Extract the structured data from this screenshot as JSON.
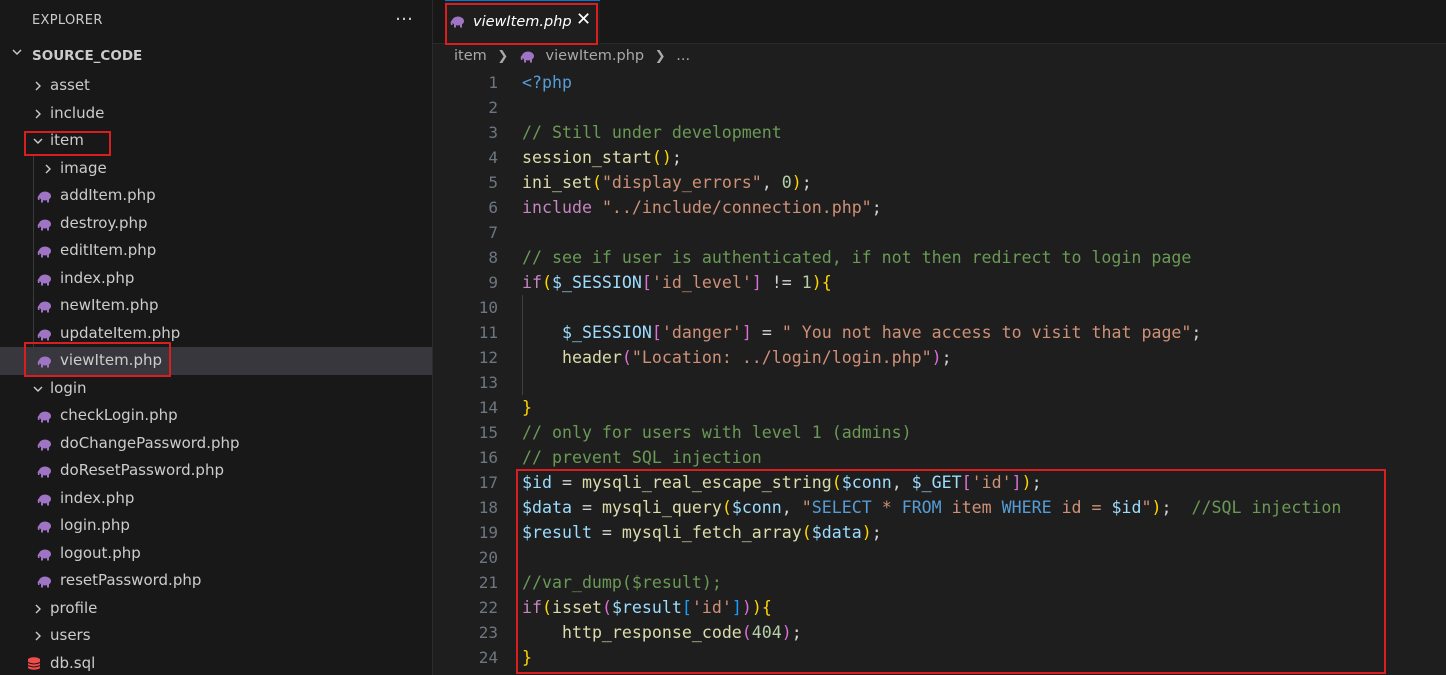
{
  "sidebar": {
    "title": "EXPLORER",
    "more_icon": "…",
    "root_label": "SOURCE_CODE",
    "items": [
      {
        "label": "asset",
        "kind": "folder",
        "expanded": false,
        "depth": 1
      },
      {
        "label": "include",
        "kind": "folder",
        "expanded": false,
        "depth": 1
      },
      {
        "label": "item",
        "kind": "folder",
        "expanded": true,
        "depth": 1
      },
      {
        "label": "image",
        "kind": "folder",
        "expanded": false,
        "depth": 2
      },
      {
        "label": "addItem.php",
        "kind": "php",
        "depth": 2
      },
      {
        "label": "destroy.php",
        "kind": "php",
        "depth": 2
      },
      {
        "label": "editItem.php",
        "kind": "php",
        "depth": 2
      },
      {
        "label": "index.php",
        "kind": "php",
        "depth": 2
      },
      {
        "label": "newItem.php",
        "kind": "php",
        "depth": 2
      },
      {
        "label": "updateItem.php",
        "kind": "php",
        "depth": 2
      },
      {
        "label": "viewItem.php",
        "kind": "php",
        "depth": 2,
        "selected": true
      },
      {
        "label": "login",
        "kind": "folder",
        "expanded": true,
        "depth": 1
      },
      {
        "label": "checkLogin.php",
        "kind": "php",
        "depth": 2
      },
      {
        "label": "doChangePassword.php",
        "kind": "php",
        "depth": 2
      },
      {
        "label": "doResetPassword.php",
        "kind": "php",
        "depth": 2
      },
      {
        "label": "index.php",
        "kind": "php",
        "depth": 2
      },
      {
        "label": "login.php",
        "kind": "php",
        "depth": 2
      },
      {
        "label": "logout.php",
        "kind": "php",
        "depth": 2
      },
      {
        "label": "resetPassword.php",
        "kind": "php",
        "depth": 2
      },
      {
        "label": "profile",
        "kind": "folder",
        "expanded": false,
        "depth": 1
      },
      {
        "label": "users",
        "kind": "folder",
        "expanded": false,
        "depth": 1
      },
      {
        "label": "db.sql",
        "kind": "db",
        "depth": 1
      }
    ]
  },
  "editor": {
    "tab": {
      "label": "viewItem.php",
      "close_icon": "✕"
    },
    "breadcrumb": {
      "folder": "item",
      "file": "viewItem.php",
      "more": "..."
    },
    "lines": [
      {
        "n": "1",
        "code": [
          [
            "kw",
            "<?php"
          ]
        ]
      },
      {
        "n": "2",
        "code": []
      },
      {
        "n": "3",
        "code": [
          [
            "cm",
            "// Still under development"
          ]
        ]
      },
      {
        "n": "4",
        "code": [
          [
            "fn",
            "session_start"
          ],
          [
            "b1",
            "()"
          ],
          [
            "p",
            ";"
          ]
        ]
      },
      {
        "n": "5",
        "code": [
          [
            "fn",
            "ini_set"
          ],
          [
            "b1",
            "("
          ],
          [
            "str",
            "\"display_errors\""
          ],
          [
            "p",
            ", "
          ],
          [
            "num",
            "0"
          ],
          [
            "b1",
            ")"
          ],
          [
            "p",
            ";"
          ]
        ]
      },
      {
        "n": "6",
        "code": [
          [
            "ctl",
            "include"
          ],
          [
            "p",
            " "
          ],
          [
            "str",
            "\"../include/connection.php\""
          ],
          [
            "p",
            ";"
          ]
        ]
      },
      {
        "n": "7",
        "code": []
      },
      {
        "n": "8",
        "code": [
          [
            "cm",
            "// see if user is authenticated, if not then redirect to login page"
          ]
        ]
      },
      {
        "n": "9",
        "code": [
          [
            "ctl",
            "if"
          ],
          [
            "b1",
            "("
          ],
          [
            "var",
            "$_SESSION"
          ],
          [
            "b2",
            "["
          ],
          [
            "str",
            "'id_level'"
          ],
          [
            "b2",
            "]"
          ],
          [
            "p",
            " != "
          ],
          [
            "num",
            "1"
          ],
          [
            "b1",
            ")"
          ],
          [
            "b1",
            "{"
          ]
        ]
      },
      {
        "n": "10",
        "code": []
      },
      {
        "n": "11",
        "code": [
          [
            "p",
            "    "
          ],
          [
            "var",
            "$_SESSION"
          ],
          [
            "b2",
            "["
          ],
          [
            "str",
            "'danger'"
          ],
          [
            "b2",
            "]"
          ],
          [
            "p",
            " = "
          ],
          [
            "str",
            "\" You not have access to visit that page\""
          ],
          [
            "p",
            ";"
          ]
        ]
      },
      {
        "n": "12",
        "code": [
          [
            "p",
            "    "
          ],
          [
            "fn",
            "header"
          ],
          [
            "b2",
            "("
          ],
          [
            "str",
            "\"Location: ../login/login.php\""
          ],
          [
            "b2",
            ")"
          ],
          [
            "p",
            ";"
          ]
        ]
      },
      {
        "n": "13",
        "code": []
      },
      {
        "n": "14",
        "code": [
          [
            "b1",
            "}"
          ]
        ]
      },
      {
        "n": "15",
        "code": [
          [
            "cm",
            "// only for users with level 1 (admins)"
          ]
        ]
      },
      {
        "n": "16",
        "code": [
          [
            "cm",
            "// prevent SQL injection"
          ]
        ]
      },
      {
        "n": "17",
        "code": [
          [
            "var",
            "$id"
          ],
          [
            "p",
            " = "
          ],
          [
            "fn",
            "mysqli_real_escape_string"
          ],
          [
            "b1",
            "("
          ],
          [
            "var",
            "$conn"
          ],
          [
            "p",
            ", "
          ],
          [
            "var",
            "$_GET"
          ],
          [
            "b2",
            "["
          ],
          [
            "str",
            "'id'"
          ],
          [
            "b2",
            "]"
          ],
          [
            "b1",
            ")"
          ],
          [
            "p",
            ";"
          ]
        ]
      },
      {
        "n": "18",
        "code": [
          [
            "var",
            "$data"
          ],
          [
            "p",
            " = "
          ],
          [
            "fn",
            "mysqli_query"
          ],
          [
            "b1",
            "("
          ],
          [
            "var",
            "$conn"
          ],
          [
            "p",
            ", "
          ],
          [
            "str",
            "\""
          ],
          [
            "sqlk",
            "SELECT"
          ],
          [
            "str",
            " * "
          ],
          [
            "sqlk",
            "FROM"
          ],
          [
            "str",
            " item "
          ],
          [
            "sqlk",
            "WHERE"
          ],
          [
            "str",
            " id = "
          ],
          [
            "var",
            "$id"
          ],
          [
            "str",
            "\""
          ],
          [
            "b1",
            ")"
          ],
          [
            "p",
            ";  "
          ],
          [
            "cm",
            "//SQL injection"
          ]
        ]
      },
      {
        "n": "19",
        "code": [
          [
            "var",
            "$result"
          ],
          [
            "p",
            " = "
          ],
          [
            "fn",
            "mysqli_fetch_array"
          ],
          [
            "b1",
            "("
          ],
          [
            "var",
            "$data"
          ],
          [
            "b1",
            ")"
          ],
          [
            "p",
            ";"
          ]
        ]
      },
      {
        "n": "20",
        "code": []
      },
      {
        "n": "21",
        "code": [
          [
            "cm",
            "//var_dump($result);"
          ]
        ]
      },
      {
        "n": "22",
        "code": [
          [
            "ctl",
            "if"
          ],
          [
            "b1",
            "("
          ],
          [
            "fn",
            "isset"
          ],
          [
            "b2",
            "("
          ],
          [
            "var",
            "$result"
          ],
          [
            "b3",
            "["
          ],
          [
            "str",
            "'id'"
          ],
          [
            "b3",
            "]"
          ],
          [
            "b2",
            ")"
          ],
          [
            "b1",
            ")"
          ],
          [
            "b1",
            "{"
          ]
        ]
      },
      {
        "n": "23",
        "code": [
          [
            "p",
            "    "
          ],
          [
            "fn",
            "http_response_code"
          ],
          [
            "b2",
            "("
          ],
          [
            "num",
            "404"
          ],
          [
            "b2",
            ")"
          ],
          [
            "p",
            ";"
          ]
        ]
      },
      {
        "n": "24",
        "code": [
          [
            "b1",
            "}"
          ]
        ]
      }
    ]
  },
  "colors": {
    "highlight_box": "#d81e1e",
    "php_icon": "#a074c4",
    "db_icon": "#f14c4c",
    "tab_accent": "#0078d4"
  }
}
